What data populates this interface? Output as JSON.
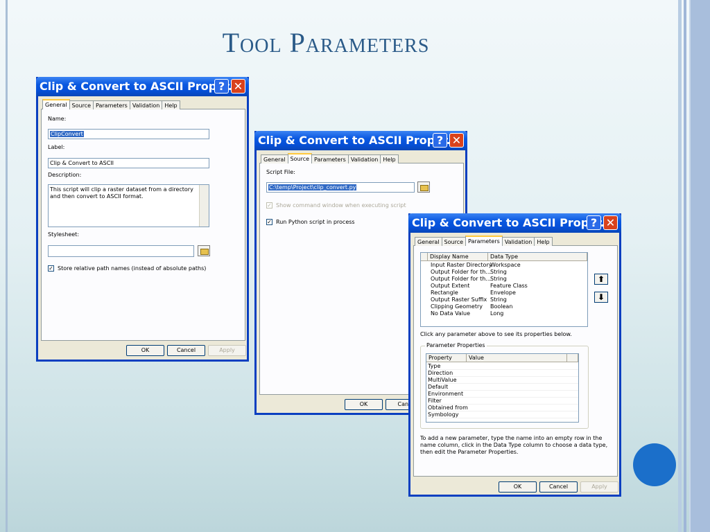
{
  "slide": {
    "title": "Tool Parameters"
  },
  "dialogs": [
    {
      "title": "Clip & Convert to ASCII Proper...",
      "help": "?",
      "close": "✕",
      "tabs": [
        "General",
        "Source",
        "Parameters",
        "Validation",
        "Help"
      ],
      "name_label": "Name:",
      "name_value": "ClipConvert",
      "label_label": "Label:",
      "label_value": "Clip & Convert to ASCII",
      "description_label": "Description:",
      "description_value": "This script will clip a raster dataset from a directory and then convert to ASCII format.",
      "stylesheet_label": "Stylesheet:",
      "stylesheet_value": "",
      "relative_paths_label": "Store relative path names (instead of absolute paths)",
      "relative_paths_checked": true,
      "ok": "OK",
      "cancel": "Cancel",
      "apply": "Apply"
    },
    {
      "title": "Clip & Convert to ASCII Proper...",
      "help": "?",
      "close": "✕",
      "tabs": [
        "General",
        "Source",
        "Parameters",
        "Validation",
        "Help"
      ],
      "script_file_label": "Script File:",
      "script_file_value": "C:\\temp\\Project\\clip_convert.py",
      "show_cmd_label": "Show command window when executing script",
      "run_in_process_label": "Run Python script in process",
      "run_in_process_checked": true,
      "ok": "OK",
      "cancel": "Canc"
    },
    {
      "title": "Clip & Convert to ASCII Proper...",
      "help": "?",
      "close": "✕",
      "tabs": [
        "General",
        "Source",
        "Parameters",
        "Validation",
        "Help"
      ],
      "param_columns": [
        "Display Name",
        "Data Type"
      ],
      "params": [
        {
          "name": "Input Raster Directory",
          "type": "Workspace"
        },
        {
          "name": "Output Folder for th...",
          "type": "String"
        },
        {
          "name": "Output Folder for th...",
          "type": "String"
        },
        {
          "name": "Output Extent",
          "type": "Feature Class"
        },
        {
          "name": "Rectangle",
          "type": "Envelope"
        },
        {
          "name": "Output Raster Suffix",
          "type": "String"
        },
        {
          "name": "Clipping Geometry",
          "type": "Boolean"
        },
        {
          "name": "No Data Value",
          "type": "Long"
        }
      ],
      "hint": "Click any parameter above to see its properties below.",
      "props_group_label": "Parameter Properties",
      "prop_columns": [
        "Property",
        "Value"
      ],
      "properties": [
        "Type",
        "Direction",
        "MultiValue",
        "Default",
        "Environment",
        "Filter",
        "Obtained from",
        "Symbology"
      ],
      "footer_line1": "To add a new parameter, type the name into an empty row in the",
      "footer_line2": "name column, click in the Data Type column to choose a data type,",
      "footer_line3": "then edit the Parameter Properties.",
      "move_up": "⬆",
      "move_down": "⬇",
      "ok": "OK",
      "cancel": "Cancel",
      "apply": "Apply"
    }
  ]
}
